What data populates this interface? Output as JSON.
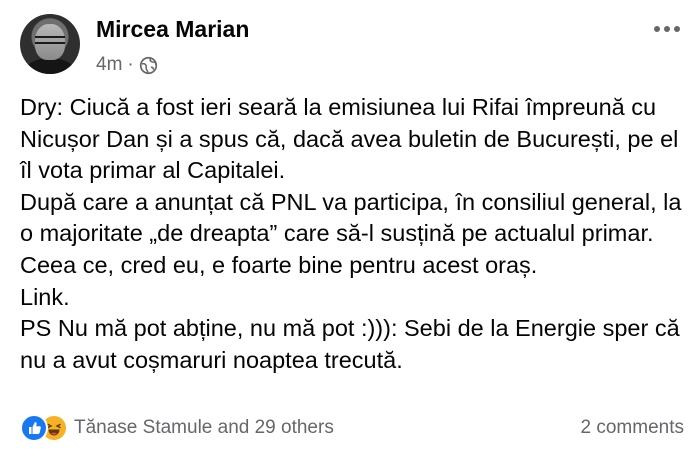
{
  "post": {
    "author": "Mircea Marian",
    "timestamp": "4m",
    "separator": "·",
    "audience_icon": "globe-icon",
    "more_icon": "more-options-icon",
    "text": "Dry: Ciucă a fost ieri seară la emisiunea lui Rifai împreună cu Nicușor Dan și a spus că, dacă avea buletin de București, pe el îl vota primar al Capitalei.\nDupă care a anunțat că PNL va participa, în consiliul general, la o majoritate „de dreapta” care să-l susțină pe actualul primar.\nCeea ce, cred eu, e foarte bine pentru acest oraș.\nLink.\nPS Nu mă pot abține, nu mă pot :))): Sebi de la Energie sper că nu a avut coșmaruri noaptea trecută."
  },
  "footer": {
    "reaction_icons": [
      "like-icon",
      "haha-icon"
    ],
    "reactions_text": "Tănase Stamule and 29 others",
    "comments_text": "2 comments"
  },
  "colors": {
    "text": "#050505",
    "secondary": "#65676b",
    "like_blue": "#1877f2",
    "haha_yellow": "#f7b125"
  }
}
